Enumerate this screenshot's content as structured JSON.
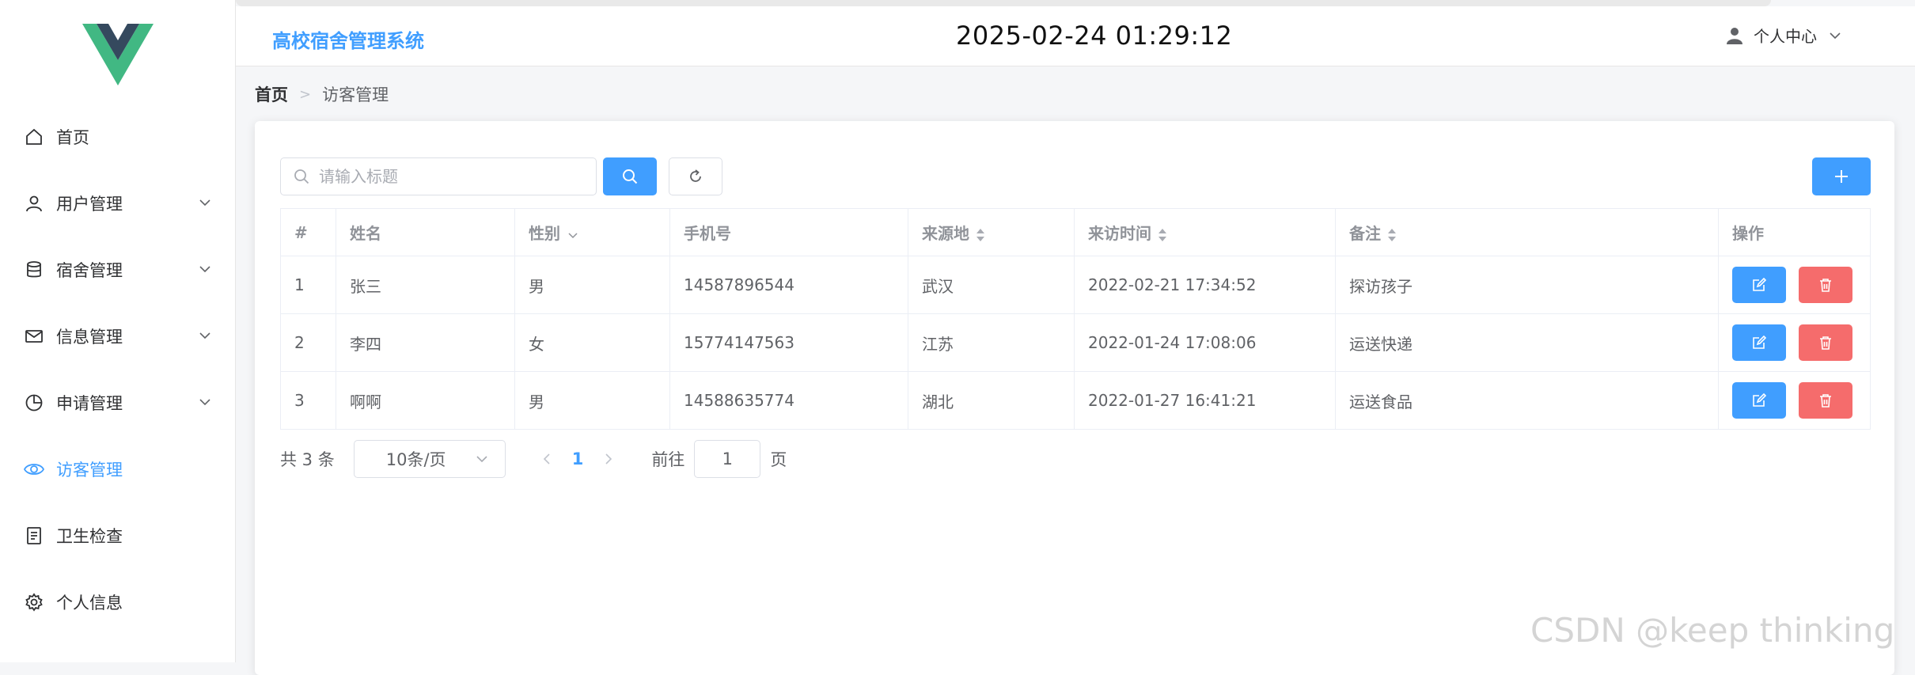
{
  "header": {
    "brand": "高校宿舍管理系统",
    "datetime": "2025-02-24 01:29:12",
    "user_center": "个人中心"
  },
  "sidebar": {
    "items": [
      {
        "label": "首页",
        "icon": "home-icon"
      },
      {
        "label": "用户管理",
        "icon": "user-icon",
        "has_submenu": true
      },
      {
        "label": "宿舍管理",
        "icon": "database-icon",
        "has_submenu": true
      },
      {
        "label": "信息管理",
        "icon": "mail-icon",
        "has_submenu": true
      },
      {
        "label": "申请管理",
        "icon": "pie-chart-icon",
        "has_submenu": true
      },
      {
        "label": "访客管理",
        "icon": "eye-icon",
        "active": true
      },
      {
        "label": "卫生检查",
        "icon": "document-icon"
      },
      {
        "label": "个人信息",
        "icon": "gear-icon"
      }
    ]
  },
  "breadcrumb": {
    "home": "首页",
    "current": "访客管理"
  },
  "search": {
    "placeholder": "请输入标题",
    "value": ""
  },
  "table": {
    "headers": [
      "#",
      "姓名",
      "性别",
      "手机号",
      "来源地",
      "来访时间",
      "备注",
      "操作"
    ],
    "rows": [
      {
        "idx": "1",
        "name": "张三",
        "gender": "男",
        "phone": "14587896544",
        "origin": "武汉",
        "time": "2022-02-21 17:34:52",
        "note": "探访孩子"
      },
      {
        "idx": "2",
        "name": "李四",
        "gender": "女",
        "phone": "15774147563",
        "origin": "江苏",
        "time": "2022-01-24 17:08:06",
        "note": "运送快递"
      },
      {
        "idx": "3",
        "name": "啊啊",
        "gender": "男",
        "phone": "14588635774",
        "origin": "湖北",
        "time": "2022-01-27 16:41:21",
        "note": "运送食品"
      }
    ]
  },
  "pagination": {
    "total": "共 3 条",
    "page_size": "10条/页",
    "current_page": "1",
    "goto_label": "前往",
    "goto_value": "1",
    "page_suffix": "页"
  },
  "watermark": "CSDN @keep   thinking",
  "colors": {
    "primary": "#409eff",
    "danger": "#f56c6c",
    "logo_green": "#41b883",
    "logo_dark": "#35495e"
  }
}
